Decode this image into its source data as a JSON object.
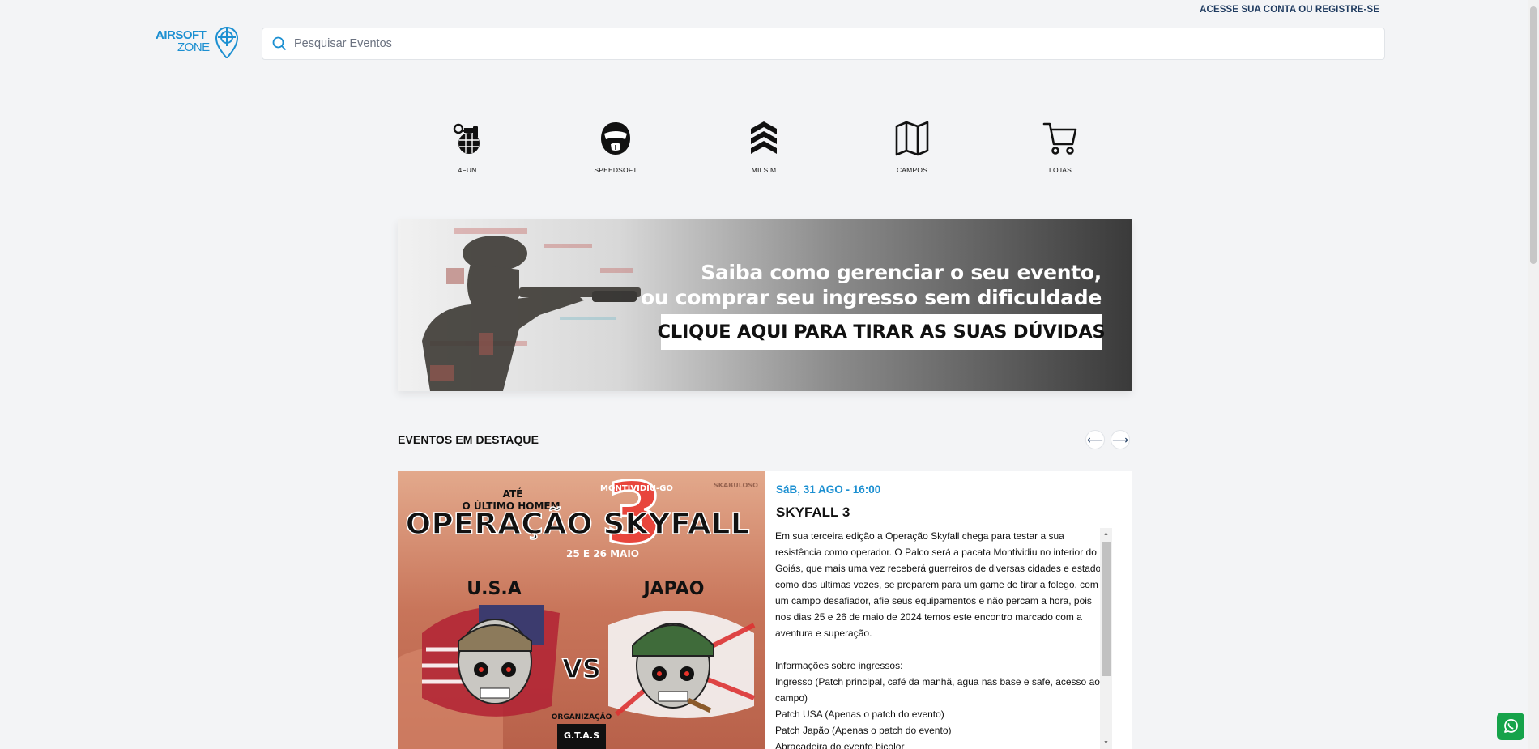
{
  "header": {
    "account_link": "ACESSE SUA CONTA OU REGISTRE-SE",
    "logo_line1": "AIRSOFT",
    "logo_line2": "ZONE",
    "search_placeholder": "Pesquisar Eventos",
    "search_value": ""
  },
  "categories": [
    {
      "label": "4FUN",
      "icon": "grenade-icon"
    },
    {
      "label": "SPEEDSOFT",
      "icon": "mask-icon"
    },
    {
      "label": "MILSIM",
      "icon": "chevrons-icon"
    },
    {
      "label": "CAMPOS",
      "icon": "map-icon"
    },
    {
      "label": "LOJAS",
      "icon": "cart-icon"
    }
  ],
  "banner": {
    "line1": "Saiba como gerenciar o seu evento,",
    "line2": "ou comprar seu ingresso sem dificuldade",
    "cta": "CLIQUE AQUI PARA TIRAR AS SUAS DÚVIDAS"
  },
  "featured": {
    "title": "EVENTOS EM DESTAQUE",
    "prev_icon": "arrow-left-icon",
    "next_icon": "arrow-right-icon",
    "event": {
      "date": "SáB, 31 AGO - 16:00",
      "name": "SKYFALL 3",
      "poster": {
        "top_small": "ATÉ",
        "top_line": "O ÚLTIMO HOMEM",
        "location": "MONTIVIDIU-GO",
        "title": "OPERAÇÃO SKYFALL",
        "number": "3",
        "dates": "25 E 26 MAIO",
        "team_left": "U.S.A",
        "team_right": "JAPAO",
        "versus": "VS",
        "org_label": "ORGANIZAÇÃO",
        "org_name": "G.T.A.S",
        "watermark": "SKABULOSO"
      },
      "description": [
        "Em sua terceira edição a Operação Skyfall chega para testar a sua resistência como operador. O Palco será a pacata Montividiu no interior do Goiás, que mais uma vez receberá guerreiros de diversas cidades e estado como das ultimas vezes, se preparem para um game de tirar a folego, com um campo desafiador, afie seus equipamentos e não percam a hora, pois nos dias 25 e 26 de maio de 2024 temos este encontro marcado com a aventura e superação.",
        "",
        "Informações sobre ingressos:",
        "Ingresso (Patch principal, café da manhã, agua nas base e safe, acesso ao campo)",
        "Patch USA (Apenas o patch do evento)",
        "Patch Japão (Apenas o patch do evento)",
        "Abracadeira do evento bicolor"
      ]
    }
  },
  "colors": {
    "accent": "#1b8fd1",
    "navy": "#1e3a5f",
    "background": "#f3f4f6",
    "whatsapp": "#16a34a"
  }
}
